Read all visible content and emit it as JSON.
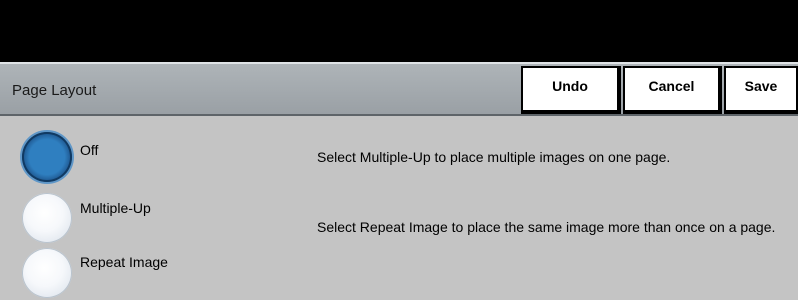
{
  "header": {
    "title": "Page Layout",
    "buttons": {
      "undo": "Undo",
      "cancel": "Cancel",
      "save": "Save"
    }
  },
  "options": [
    {
      "label": "Off",
      "selected": true
    },
    {
      "label": "Multiple-Up",
      "selected": false
    },
    {
      "label": "Repeat Image",
      "selected": false
    }
  ],
  "descriptions": {
    "multiple_up": "Select Multiple-Up to place multiple images on one page.",
    "repeat_image": "Select Repeat Image to place the same image more than once on a page."
  },
  "colors": {
    "selected_radio": "#2f7fc0",
    "background": "#c4c4c4",
    "top_bar": "#000000"
  }
}
